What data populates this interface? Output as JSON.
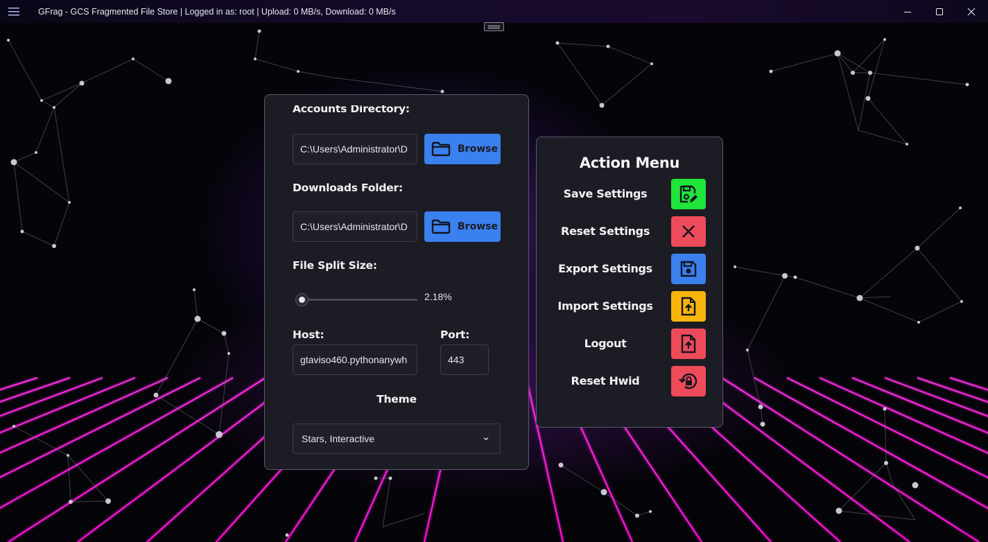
{
  "window": {
    "title": "GFrag - GCS Fragmented File Store | Logged in as: root | Upload: 0 MB/s, Download: 0 MB/s",
    "controls": [
      "minimize-icon",
      "maximize-icon",
      "close-icon"
    ]
  },
  "settings": {
    "accounts_label": "Accounts Directory:",
    "accounts_value": "C:\\Users\\Administrator\\D",
    "downloads_label": "Downloads Folder:",
    "downloads_value": "C:\\Users\\Administrator\\D",
    "browse_label": "Browse",
    "split_label": "File Split Size:",
    "split_value": "2.18%",
    "split_fraction": 0.0218,
    "host_label": "Host:",
    "host_value": "gtaviso460.pythonanywh",
    "port_label": "Port:",
    "port_value": "443",
    "theme_label": "Theme",
    "theme_value": "Stars, Interactive"
  },
  "action_menu": {
    "title": "Action Menu",
    "items": [
      {
        "label": "Save Settings",
        "icon": "save-edit-icon",
        "color": "#1fe43a"
      },
      {
        "label": "Reset Settings",
        "icon": "close-icon",
        "color": "#ee4b5a"
      },
      {
        "label": "Export Settings",
        "icon": "floppy-icon",
        "color": "#3a80ee"
      },
      {
        "label": "Import Settings",
        "icon": "file-upload-icon",
        "color": "#f7b50c"
      },
      {
        "label": "Logout",
        "icon": "file-upload-icon",
        "color": "#ee4b5a"
      },
      {
        "label": "Reset Hwid",
        "icon": "lock-reset-icon",
        "color": "#ee4b5a"
      }
    ]
  },
  "colors": {
    "accent_blue": "#3a80ee",
    "grid_magenta": "#ff1ee0",
    "panel_bg": "#1c1c24"
  }
}
